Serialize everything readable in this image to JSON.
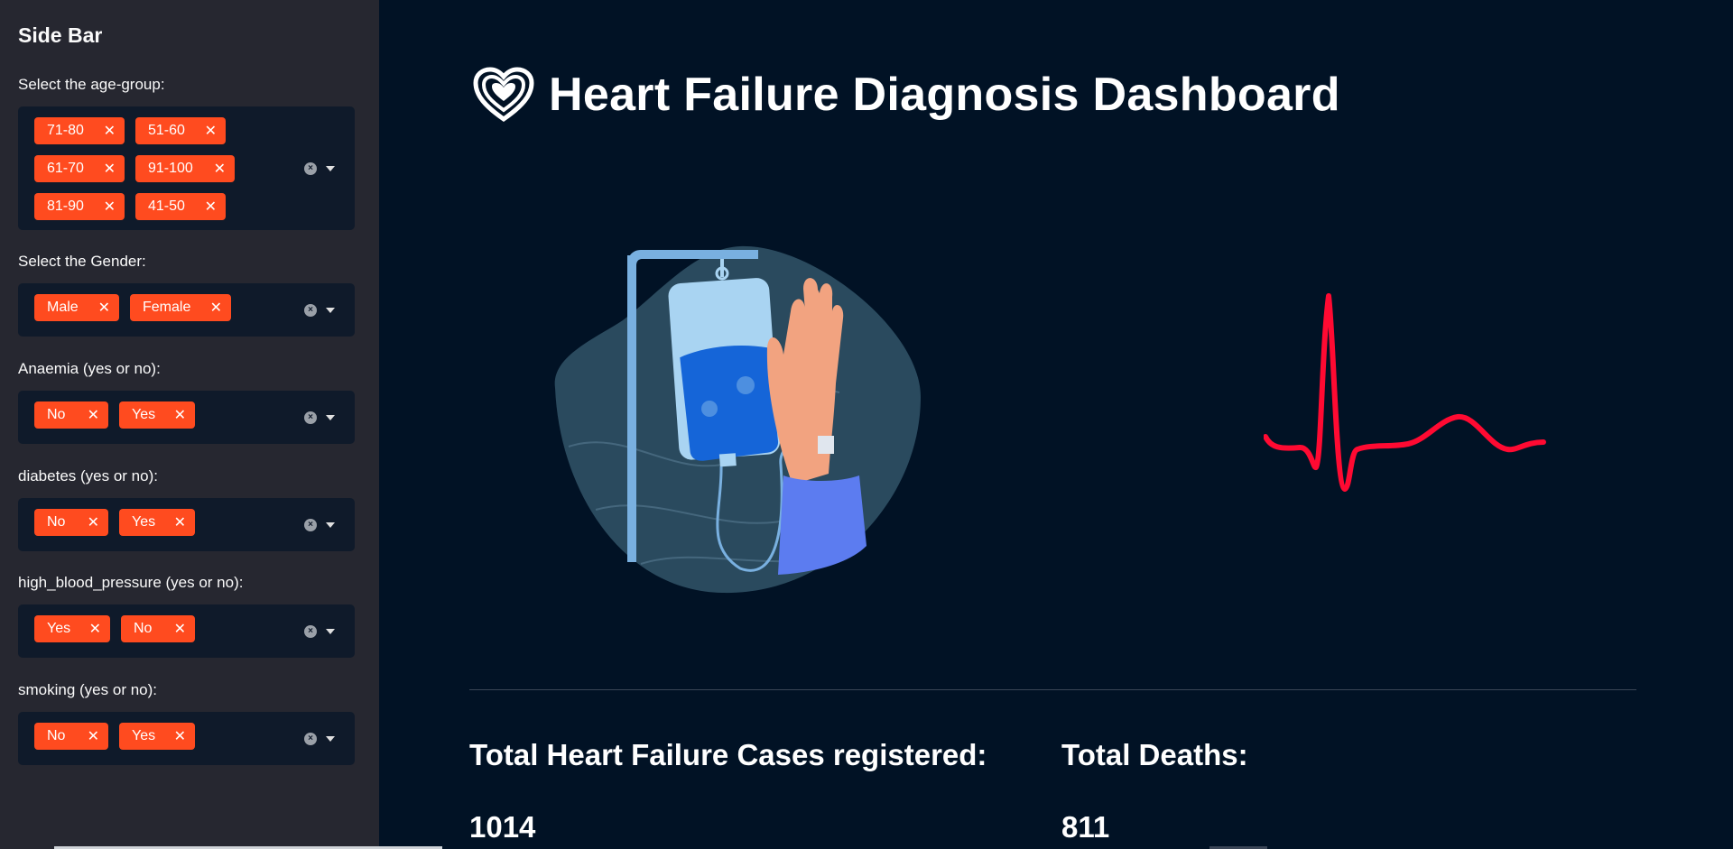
{
  "sidebar": {
    "title": "Side Bar",
    "filters": [
      {
        "label": "Select the age-group:",
        "tags": [
          "71-80",
          "51-60",
          "61-70",
          "91-100",
          "81-90",
          "41-50"
        ]
      },
      {
        "label": "Select the Gender:",
        "tags": [
          "Male",
          "Female"
        ]
      },
      {
        "label": "Anaemia (yes or no):",
        "tags": [
          "No",
          "Yes"
        ]
      },
      {
        "label": "diabetes (yes or no):",
        "tags": [
          "No",
          "Yes"
        ]
      },
      {
        "label": "high_blood_pressure (yes or no):",
        "tags": [
          "Yes",
          "No"
        ]
      },
      {
        "label": "smoking (yes or no):",
        "tags": [
          "No",
          "Yes"
        ]
      }
    ],
    "tag_remove_glyph": "✕"
  },
  "main": {
    "title": "Heart Failure Diagnosis Dashboard",
    "metrics": [
      {
        "label": "Total Heart Failure Cases registered:",
        "value": "1014"
      },
      {
        "label": "Total Deaths:",
        "value": "811"
      }
    ]
  },
  "colors": {
    "tag_bg": "#ff4b1f",
    "ecg_line": "#ff0a32",
    "page_bg": "#011225",
    "sidebar_bg": "#262730"
  }
}
